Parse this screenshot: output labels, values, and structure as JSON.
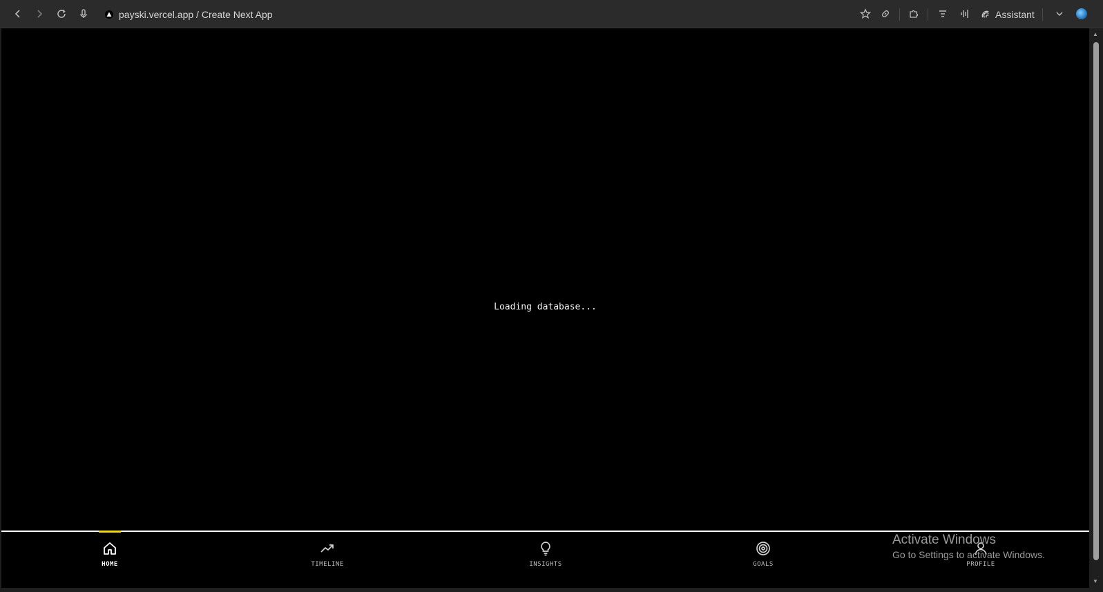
{
  "browser": {
    "address": "payski.vercel.app / Create Next App",
    "assistant_label": "Assistant",
    "icons": {
      "back": "back-arrow-icon",
      "forward": "forward-arrow-icon",
      "reload": "reload-icon",
      "mic": "microphone-icon",
      "star": "star-icon",
      "link": "link-icon",
      "extensions": "puzzle-icon",
      "reader": "reader-icon",
      "audio": "waveform-icon",
      "dropdown": "chevron-down-icon",
      "profile": "globe-icon"
    }
  },
  "page": {
    "loading_text": "Loading database..."
  },
  "nav": {
    "accent_color": "#f5d90a",
    "items": [
      {
        "label": "HOME",
        "icon": "home-icon",
        "active": true
      },
      {
        "label": "TIMELINE",
        "icon": "trend-up-icon",
        "active": false
      },
      {
        "label": "INSIGHTS",
        "icon": "lightbulb-icon",
        "active": false
      },
      {
        "label": "GOALS",
        "icon": "target-icon",
        "active": false
      },
      {
        "label": "PROFILE",
        "icon": "user-icon",
        "active": false
      }
    ]
  },
  "watermark": {
    "title": "Activate Windows",
    "subtitle": "Go to Settings to activate Windows."
  }
}
